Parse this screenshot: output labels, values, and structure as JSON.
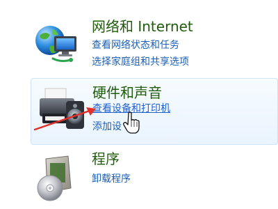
{
  "categories": {
    "network": {
      "title": "网络和 Internet",
      "links": [
        "查看网络状态和任务",
        "选择家庭组和共享选项"
      ],
      "icon": "network-globe-icon"
    },
    "hardware": {
      "title": "硬件和声音",
      "links": [
        "查看设备和打印机",
        "添加设"
      ],
      "icon": "printer-speaker-icon"
    },
    "programs": {
      "title": "程序",
      "links": [
        "卸载程序"
      ],
      "icon": "programs-disc-box-icon"
    }
  },
  "colors": {
    "category_title": "#1f5c0b",
    "task_link": "#1c5fb3",
    "hover_border": "#cfe4fb",
    "annotation_arrow": "#e0302a"
  },
  "overlay": {
    "annotation": "red-arrow-pointer",
    "cursor": "hand-pointer-cursor"
  }
}
